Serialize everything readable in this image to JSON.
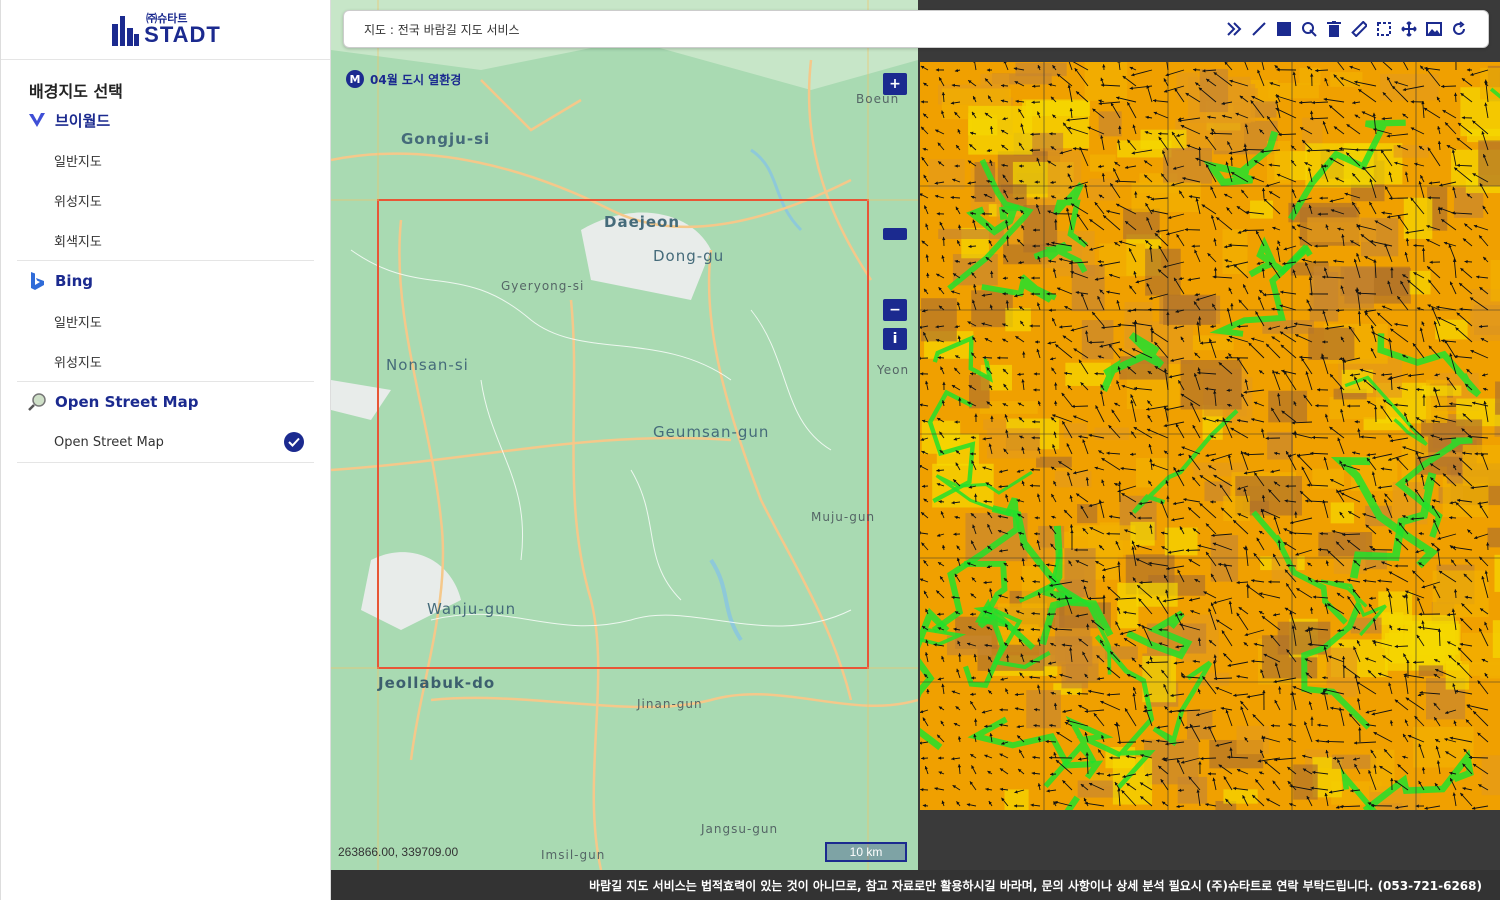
{
  "brand": {
    "small": "㈜슈타트",
    "big": "STADT"
  },
  "sidebar": {
    "title": "배경지도 선택",
    "groups": [
      {
        "name": "브이월드",
        "items": [
          "일반지도",
          "위성지도",
          "회색지도"
        ]
      },
      {
        "name": "Bing",
        "items": [
          "일반지도",
          "위성지도"
        ]
      },
      {
        "name": "Open Street Map",
        "items": [
          "Open Street Map"
        ]
      }
    ]
  },
  "toolbar": {
    "title": "지도 : 전국 바람길 지도 서비스"
  },
  "map": {
    "layer_label": "04월 도시 열환경",
    "layer_badge": "M",
    "coords": "263866.00, 339709.00",
    "scale": "10 km",
    "zoom_in": "+",
    "zoom_out": "−",
    "info": "i",
    "labels": {
      "gongju": "Gongju-si",
      "daejeon": "Daejeon",
      "donggu": "Dong-gu",
      "gyeryong": "Gyeryong-si",
      "nonsan": "Nonsan-si",
      "geumsan": "Geumsan-gun",
      "wanju": "Wanju-gun",
      "jeollabuk": "Jeollabuk-do",
      "jinan": "Jinan-gun",
      "muju": "Muju-gun",
      "jangsu": "Jangsu-gun",
      "imsil": "Imsil-gun",
      "boeun": "Boeun",
      "yeong": "Yeon"
    }
  },
  "footer": "바람길 지도 서비스는 법적효력이 있는 것이 아니므로, 참고 자료로만 활용하시길 바라며, 문의 사항이나 상세 분석 필요시 (주)슈타트로 연락 부탁드립니다. (053-721-6268)"
}
